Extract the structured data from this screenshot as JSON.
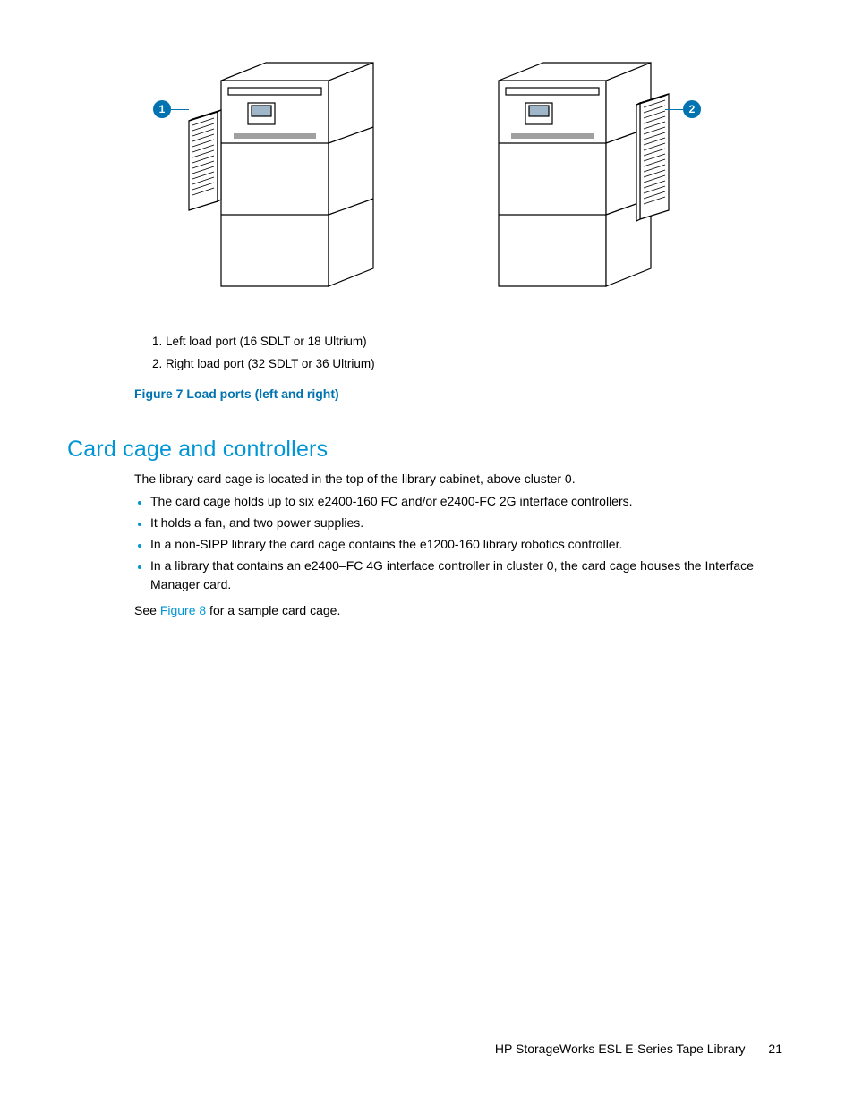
{
  "figure": {
    "callouts": {
      "left": "1",
      "right": "2"
    },
    "legend_items": [
      "1. Left load port (16 SDLT or 18 Ultrium)",
      "2. Right load port (32 SDLT or 36 Ultrium)"
    ],
    "caption": "Figure 7 Load ports (left and right)"
  },
  "section": {
    "heading": "Card cage and controllers",
    "intro": "The library card cage is located in the top of the library cabinet, above cluster 0.",
    "bullets": [
      "The card cage holds up to six e2400-160 FC and/or e2400-FC 2G interface controllers.",
      "It holds a fan, and two power supplies.",
      "In a non-SIPP library the card cage contains the e1200-160 library robotics controller.",
      "In a library that contains an e2400–FC 4G interface controller in cluster 0, the card cage houses the Interface Manager card."
    ],
    "outro_pre": "See ",
    "outro_link": "Figure 8",
    "outro_post": " for a sample card cage."
  },
  "footer": {
    "title": "HP StorageWorks ESL E-Series Tape Library",
    "page": "21"
  }
}
